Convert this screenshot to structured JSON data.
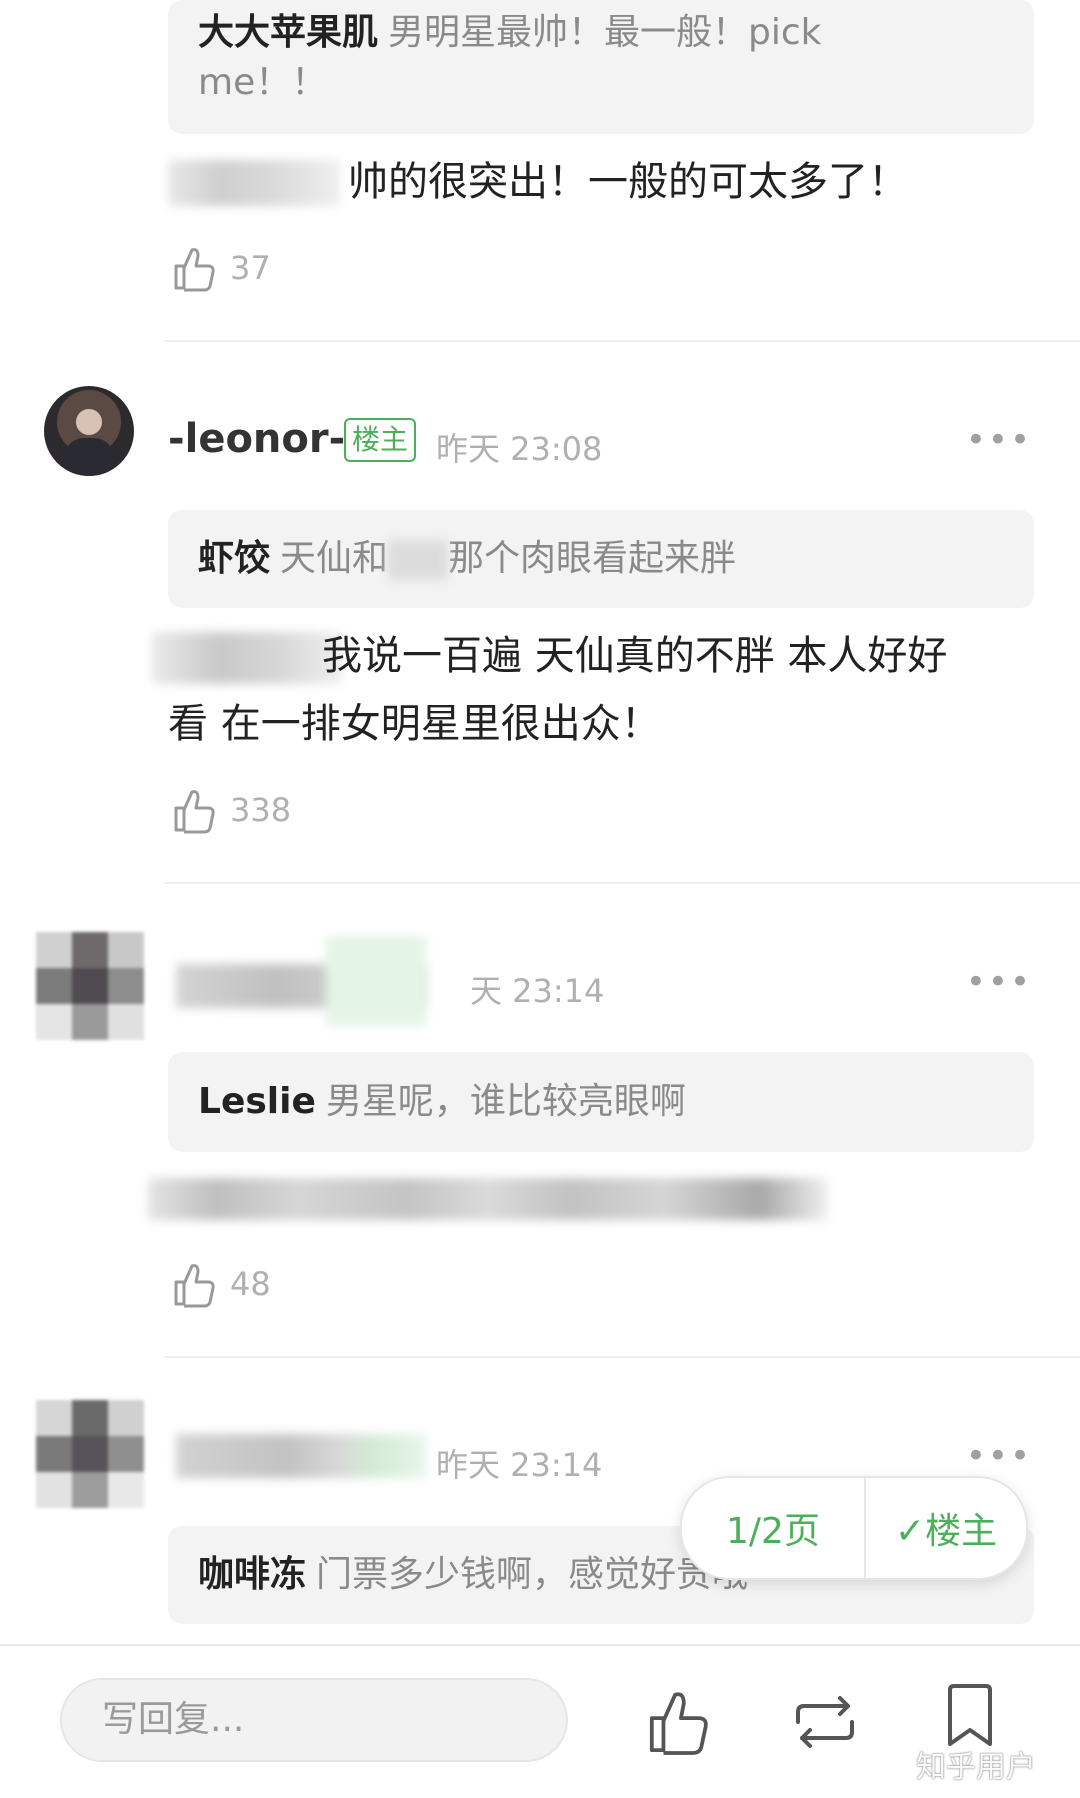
{
  "comments": [
    {
      "quote_name": "大大苹果肌",
      "quote_text": "男明星最帅！最一般！pick",
      "quote_text2": "me！！",
      "body": "帅的很突出！一般的可太多了！",
      "likes": "37"
    },
    {
      "author": "-leonor-",
      "badge": "楼主",
      "time": "昨天 23:08",
      "more": "•••",
      "quote_name": "虾饺",
      "quote_text_a": "天仙和",
      "quote_text_b": "那个肉眼看起来胖",
      "body_line1": "我说一百遍 天仙真的不胖 本人好好",
      "body_line2": "看 在一排女明星里很出众！",
      "likes": "338"
    },
    {
      "time": "天 23:14",
      "more": "•••",
      "quote_name": "Leslie",
      "quote_text": "男星呢，谁比较亮眼啊",
      "likes": "48"
    },
    {
      "time": "昨天 23:14",
      "more": "•••",
      "quote_name": "咖啡冻",
      "quote_text": "门票多少钱啊，感觉好贵哦"
    }
  ],
  "pager": {
    "page": "1/2页",
    "filter": "楼主",
    "check": "✓"
  },
  "bottom_bar": {
    "reply_placeholder": "写回复...",
    "icons": [
      "thumbs-up-icon",
      "repost-icon",
      "bookmark-icon"
    ]
  },
  "watermark": "知乎用户",
  "colors": {
    "accent_green": "#4cb05a",
    "muted_gray": "#b0b0b0"
  }
}
